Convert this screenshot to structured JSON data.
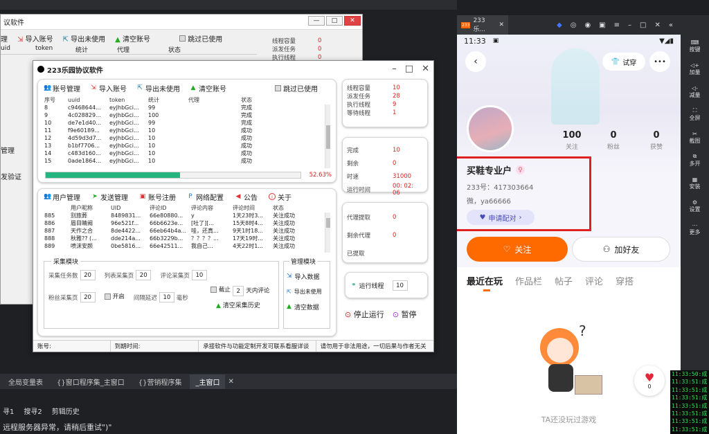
{
  "colors": {
    "accent_orange": "#ff6a00",
    "red_value": "#dd2222",
    "progress_green": "#26b57e",
    "highlight_box": "#e02020",
    "console_green": "#36e05a"
  },
  "ide": {
    "tabs": [
      "全局变量表",
      "{}窗口程序集_主窗口",
      "{}营销程序集",
      "_主窗口"
    ],
    "bottom_tabs": [
      "寻1",
      "搜寻2",
      "剪辑历史"
    ],
    "bottom_text": "远程服务器异常，请稍后重试\")\"",
    "console_lines": [
      "11:33:50:成",
      "11:33:51:成",
      "11:33:51:成",
      "11:33:51:成",
      "11:33:51:成",
      "11:33:51:成",
      "11:33:51:成",
      "11:33:51:成"
    ]
  },
  "back_window": {
    "title": "议软件",
    "toolbar": [
      "理",
      "导入账号",
      "导出未使用",
      "清空账号",
      "跳过已使用"
    ],
    "headers": [
      "uid",
      "token",
      "统计",
      "代理",
      "状态"
    ],
    "stats": [
      {
        "k": "线程容量",
        "v": "0"
      },
      {
        "k": "派发任务",
        "v": "0"
      },
      {
        "k": "执行线程",
        "v": "0"
      }
    ],
    "left_labels": [
      "管理",
      "发验证"
    ]
  },
  "window": {
    "title": "223乐园协议软件",
    "toolbar": {
      "account_mgmt": "账号管理",
      "import": "导入账号",
      "export": "导出未使用",
      "clear": "清空账号",
      "skip_used": "跳过已使用"
    },
    "account_table": {
      "headers": [
        "序号",
        "uuid",
        "token",
        "统计",
        "代理",
        "状态"
      ],
      "rows": [
        [
          "8",
          "c9468644...",
          "eyJhbGci...",
          "99",
          "",
          "完成"
        ],
        [
          "9",
          "4c028829...",
          "eyJhbGci...",
          "100",
          "",
          "完成"
        ],
        [
          "10",
          "de7e1d40...",
          "eyJhbGci...",
          "99",
          "",
          "完成"
        ],
        [
          "11",
          "f9e60189...",
          "eyJhbGci...",
          "10",
          "",
          "成功"
        ],
        [
          "12",
          "4d59d3d7...",
          "eyJhbGci...",
          "10",
          "",
          "成功"
        ],
        [
          "13",
          "b1bf7706...",
          "eyJhbGci...",
          "10",
          "",
          "成功"
        ],
        [
          "14",
          "c483d160...",
          "eyJhbGci...",
          "10",
          "",
          "成功"
        ],
        [
          "15",
          "0ade1864...",
          "eyJhbGci...",
          "10",
          "",
          "成功"
        ]
      ]
    },
    "progress": {
      "percent_label": "52.63%",
      "fraction": 0.5263
    },
    "stats1": [
      {
        "k": "线程容量",
        "v": "10"
      },
      {
        "k": "派发任务",
        "v": "28"
      },
      {
        "k": "执行线程",
        "v": "9"
      },
      {
        "k": "等待线程",
        "v": "1"
      }
    ],
    "stats2": [
      {
        "k": "完成",
        "v": "10"
      },
      {
        "k": "剩余",
        "v": "0"
      },
      {
        "k": "时速",
        "v": "31000"
      },
      {
        "k": "运行时间",
        "v": "00: 02: 06"
      }
    ],
    "stats3": [
      {
        "k": "代理提取",
        "v": "0"
      },
      {
        "k": "剩余代理",
        "v": "0"
      },
      {
        "k": "已提取",
        "v": ""
      }
    ],
    "menu": {
      "user": "用户管理",
      "send": "发送管理",
      "register": "账号注册",
      "network": "网络配置",
      "notice": "公告",
      "about": "关于"
    },
    "user_table": {
      "headers": [
        "",
        "用户昵称",
        "UID",
        "评论ID",
        "评论内容",
        "评论时间",
        "状态"
      ],
      "rows": [
        [
          "885",
          "别旅葬",
          "8489831...",
          "66e80880...",
          "y",
          "1天23时3...",
          "关注成功"
        ],
        [
          "886",
          "眉目睛阙",
          "96e521f...",
          "66b6623e...",
          "[吐了][...",
          "15天8时4...",
          "关注成功"
        ],
        [
          "887",
          "天作之合",
          "8de4422...",
          "66eb64b4a...",
          "哇，还真...",
          "9天1时18...",
          "关注成功"
        ],
        [
          "888",
          "秋雅?? (...",
          "dde214a...",
          "66b3229b...",
          "？？？？...",
          "17天19时...",
          "关注成功"
        ],
        [
          "889",
          "喷沫安颜",
          "0be5816...",
          "66e42511...",
          "我自己...",
          "4天22时1...",
          "关注成功"
        ]
      ]
    },
    "collect": {
      "title": "采集模块",
      "task_count_label": "采集任务数",
      "task_count": "20",
      "list_page_label": "列表采集页",
      "list_page": "20",
      "comment_page_label": "评论采集页",
      "comment_page": "10",
      "fans_page_label": "粉丝采集页",
      "fans_page": "20",
      "start": "开启",
      "cutoff": "截止",
      "cutoff_days": "2",
      "days_comment": "天内评论",
      "interval_label": "间隔延迟",
      "interval": "10",
      "ms": "毫秒",
      "clear_history": "清空采集历史"
    },
    "manage": {
      "title": "管理模块",
      "import": "导入数据",
      "export_unused": "导出未使用",
      "clear": "清空数据"
    },
    "run": {
      "threads_label": "运行线程",
      "threads": "10",
      "stop": "停止运行",
      "pause": "暂停"
    },
    "status_bar": {
      "account": "账号:",
      "expire": "到期时间:",
      "ad": "承接软件与功能定制开发可联系看服详谈",
      "warning": "请勿用于非法用途，一切后果与作者无关"
    }
  },
  "emulator": {
    "tab_title": "233乐...",
    "sidebar": [
      "按键",
      "加量",
      "减量",
      "全屏",
      "截图",
      "多开",
      "安装",
      "设置",
      "更多"
    ]
  },
  "phone": {
    "time": "11:33",
    "tryon": "试穿",
    "stats": [
      {
        "n": "100",
        "l": "关注"
      },
      {
        "n": "0",
        "l": "粉丝"
      },
      {
        "n": "0",
        "l": "获赞"
      }
    ],
    "username": "买鞋专业户",
    "id_line": "233号：417303664",
    "wechat_line": "微，ya66666",
    "pair_btn": "申请配对",
    "follow_btn": "关注",
    "add_friend_btn": "加好友",
    "tabs": [
      "最近在玩",
      "作品栏",
      "帖子",
      "评论",
      "穿搭"
    ],
    "heart_count": "0",
    "empty_text": "TA还没玩过游戏"
  }
}
